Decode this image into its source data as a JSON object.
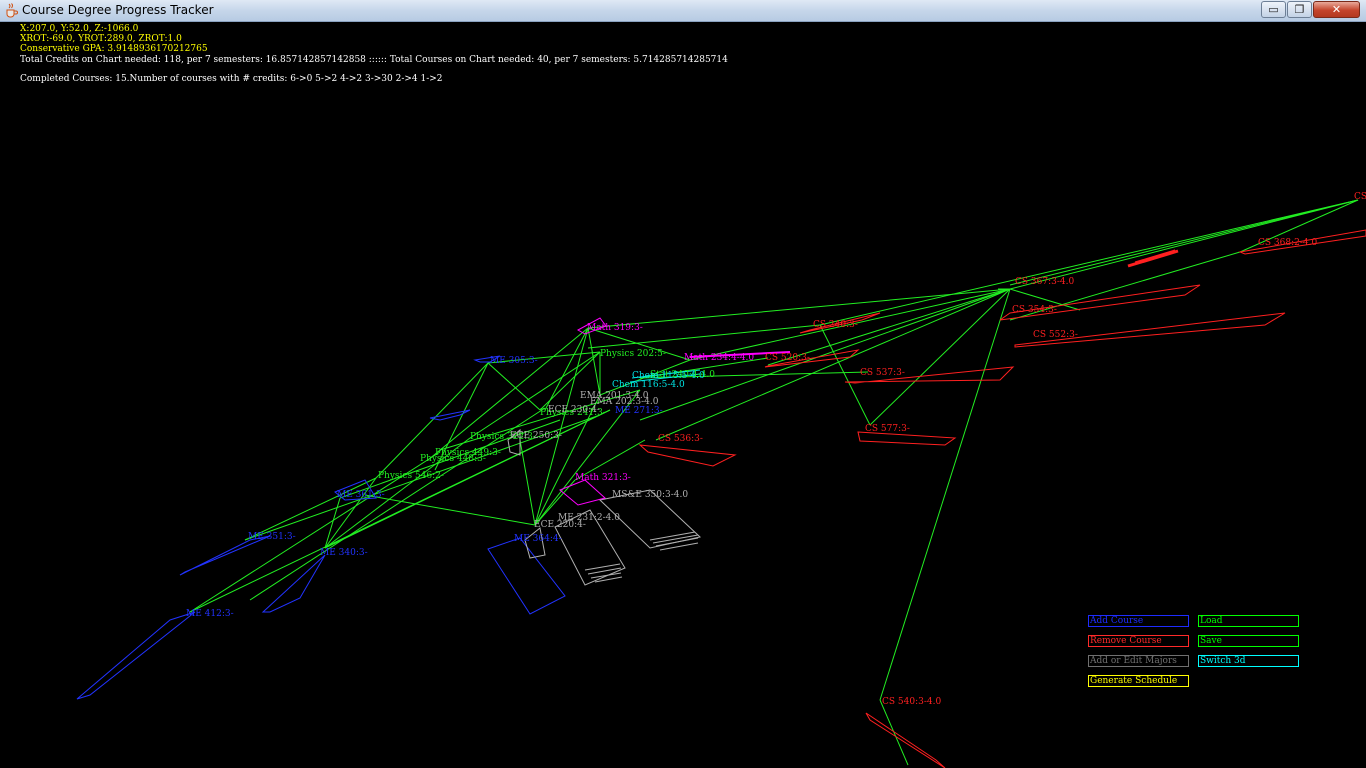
{
  "window": {
    "title": "Course Degree Progress Tracker",
    "controls": {
      "minimize": "▭",
      "maximize": "❐",
      "close": "✕"
    }
  },
  "hud": {
    "position": "X:207.0, Y:52.0, Z:-1066.0",
    "rotation": "XROT:-69.0, YROT:289.0, ZROT:1.0",
    "gpa": "Conservative GPA: 3.9148936170212765",
    "credits": "Total Credits on Chart needed: 118, per 7 semesters: 16.857142857142858 :::::: Total Courses on Chart needed: 40, per 7 semesters: 5.714285714285714",
    "completed": "Completed Courses: 15.Number of courses with # credits: 6->0 5->2 4->2 3->30 2->4 1->2"
  },
  "colors": {
    "background": "#000000",
    "hud_yellow": "#ffff00",
    "hud_white": "#ffffff",
    "edge": "#22ee22",
    "cs_course": "#ff2020",
    "me_course": "#2233ff",
    "math_course": "#ff00ff",
    "physics_course": "#22ee22",
    "chem_course": "#00e5e5",
    "completed_course": "#b0b0b0"
  },
  "courses": {
    "cs_top": "CS",
    "cs_368": "CS 368:2-4.0",
    "cs_367": "CS 367:3-4.0",
    "cs_354": "CS 354:3-",
    "cs_552": "CS 552:3-",
    "cs_240": "CS 240:3-",
    "cs_520": "CS 520:3-",
    "cs_537": "CS 537:3-",
    "cs_577": "CS 577:3-",
    "cs_536": "CS 536:3-",
    "cs_540": "CS 540:3-4.0",
    "math_319": "Math 319:3-",
    "math_321": "Math 321:3-",
    "math_cluster": "Math 234:4-4.0",
    "physics_202": "Physics 202:5-",
    "physics_241": "Physics 241:3-",
    "physics_322": "Physics 322:3-",
    "physics_448": "Physics 448:3-",
    "physics_449": "Physics 449:3-",
    "physics_546": "Physics 546:2-",
    "chem_116": "Chem 116:5-4.0",
    "chem_cluster": "Chem 115:5-4.0",
    "stat_cluster": "Stat 240:4-4.0",
    "me_305": "ME 305:3-",
    "me_271": "ME 271:3-",
    "me_361": "ME 361:3-",
    "me_351": "ME 351:3-",
    "me_340": "ME 340:3-",
    "me_364": "ME 364:4-",
    "me_412": "ME 412:3-",
    "me_231": "ME 231:2-4.0",
    "mse_350": "MS&E 350:3-4.0",
    "ece_250": "ECE 250:3-",
    "ece_220": "ECE 220:4-",
    "ece_cluster": "ECE 230:4-",
    "completed_cluster": "EMA 201:3-4.0",
    "completed_cluster_2": "EMA 202:3-4.0"
  },
  "buttons": {
    "add_course": "Add Course",
    "load": "Load",
    "remove_course": "Remove Course",
    "save": "Save",
    "edit_majors": "Add or Edit Majors",
    "switch_3d": "Switch 3d",
    "generate_schedule": "Generate Schedule"
  }
}
